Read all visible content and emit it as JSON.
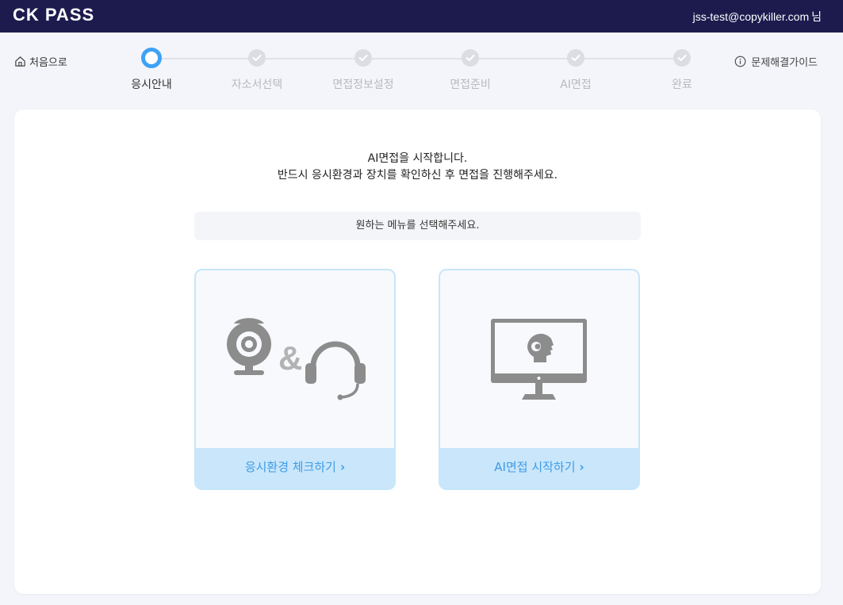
{
  "header": {
    "logo": "CK PASS",
    "user_email": "jss-test@copykiller.com",
    "user_suffix": "님"
  },
  "nav": {
    "home_label": "처음으로",
    "guide_label": "문제해결가이드"
  },
  "steps": [
    {
      "label": "응시안내",
      "state": "current"
    },
    {
      "label": "자소서선택",
      "state": "pending"
    },
    {
      "label": "면접정보설정",
      "state": "pending"
    },
    {
      "label": "면접준비",
      "state": "pending"
    },
    {
      "label": "AI면접",
      "state": "pending"
    },
    {
      "label": "완료",
      "state": "pending"
    }
  ],
  "main": {
    "intro_line1": "AI면접을 시작합니다.",
    "intro_line2": "반드시 응시환경과 장치를 확인하신 후 면접을 진행해주세요.",
    "menu_prompt": "원하는 메뉴를 선택해주세요.",
    "options": [
      {
        "label": "응시환경 체크하기",
        "icon": "webcam-and-headset-icon"
      },
      {
        "label": "AI면접 시작하기",
        "icon": "ai-monitor-icon"
      }
    ]
  },
  "colors": {
    "topbar": "#1d1b4e",
    "accent": "#3ea2f5",
    "cta_bg": "#c9e6fb",
    "cta_text": "#3d9ce6"
  }
}
